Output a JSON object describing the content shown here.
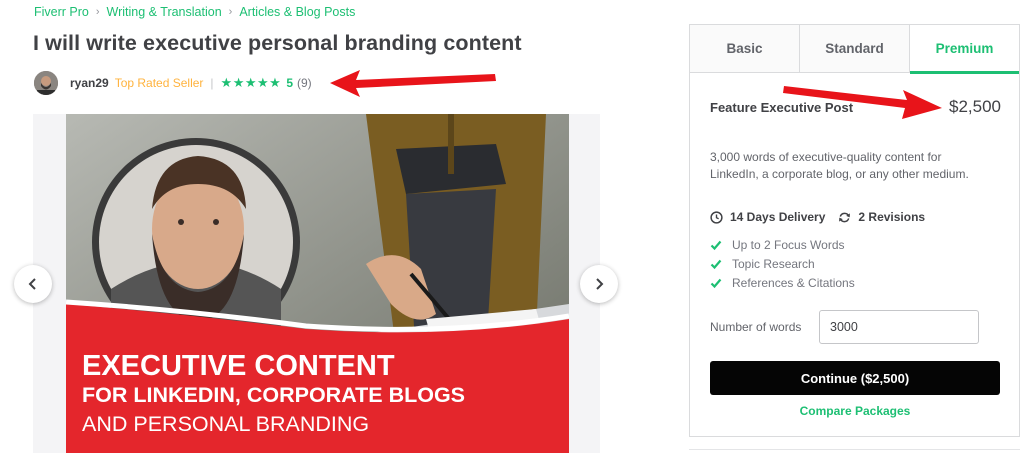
{
  "breadcrumb": {
    "items": [
      "Fiverr Pro",
      "Writing & Translation",
      "Articles & Blog Posts"
    ],
    "separator": "›"
  },
  "gig": {
    "title": "I will write executive personal branding content"
  },
  "seller": {
    "username": "ryan29",
    "level": "Top Rated Seller",
    "divider": "|",
    "stars": "★★★★★",
    "rating": "5",
    "reviews": "(9)"
  },
  "gallery": {
    "banner_line1": "EXECUTIVE CONTENT",
    "banner_line2": "FOR LINKEDIN, CORPORATE BLOGS",
    "banner_line3": "AND PERSONAL BRANDING",
    "prev_icon": "chevron-left-icon",
    "next_icon": "chevron-right-icon"
  },
  "package": {
    "tabs": [
      "Basic",
      "Standard",
      "Premium"
    ],
    "active_tab": "Premium",
    "name": "Feature Executive Post",
    "price": "$2,500",
    "description": "3,000 words of executive-quality content for LinkedIn, a corporate blog, or any other medium.",
    "delivery": "14 Days Delivery",
    "revisions": "2 Revisions",
    "features": [
      "Up to 2 Focus Words",
      "Topic Research",
      "References & Citations"
    ],
    "words_label": "Number of words",
    "words_value": "3000",
    "continue_label": "Continue ($2,500)",
    "compare_label": "Compare Packages"
  },
  "colors": {
    "brand_green": "#1dbf73",
    "top_rated": "#ffb33e",
    "annotation_red": "#e8141a",
    "banner_red": "#e4262c",
    "button_black": "#050505"
  }
}
